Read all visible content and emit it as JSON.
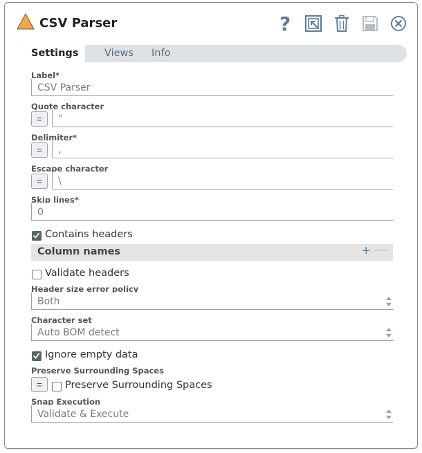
{
  "window": {
    "title": "CSV Parser"
  },
  "toolbar": {
    "icons": [
      "help-icon",
      "export-icon",
      "delete-icon",
      "save-icon",
      "close-icon"
    ]
  },
  "tabs": [
    {
      "label": "Settings",
      "active": true
    },
    {
      "label": "Views"
    },
    {
      "label": "Info"
    }
  ],
  "form": {
    "label": {
      "label": "Label*",
      "value": "CSV Parser"
    },
    "quote_character": {
      "label": "Quote character",
      "value": "\"",
      "toggle": "="
    },
    "delimiter": {
      "label": "Delimiter*",
      "value": ",",
      "toggle": "="
    },
    "escape_character": {
      "label": "Escape character",
      "value": "\\",
      "toggle": "="
    },
    "skip_lines": {
      "label": "Skip lines*",
      "value": "0"
    },
    "contains_headers": {
      "label": "Contains headers",
      "checked": true
    },
    "column_names": {
      "title": "Column names",
      "add": "+",
      "remove": "—"
    },
    "validate_headers": {
      "label": "Validate headers",
      "checked": false
    },
    "header_size_error_policy": {
      "label": "Header size error policy",
      "value": "Both"
    },
    "character_set": {
      "label": "Character set",
      "value": "Auto BOM detect"
    },
    "ignore_empty_data": {
      "label": "Ignore empty data",
      "checked": true
    },
    "preserve_surrounding_spaces": {
      "label": "Preserve Surrounding Spaces",
      "checkbox_label": "Preserve Surrounding Spaces",
      "checked": false,
      "toggle": "="
    },
    "snap_execution": {
      "label": "Snap Execution",
      "value": "Validate & Execute"
    }
  },
  "colors": {
    "accent": "#5b7fa6",
    "warning_icon": "#f0a64a",
    "tab_bar": "#dde2e6"
  }
}
